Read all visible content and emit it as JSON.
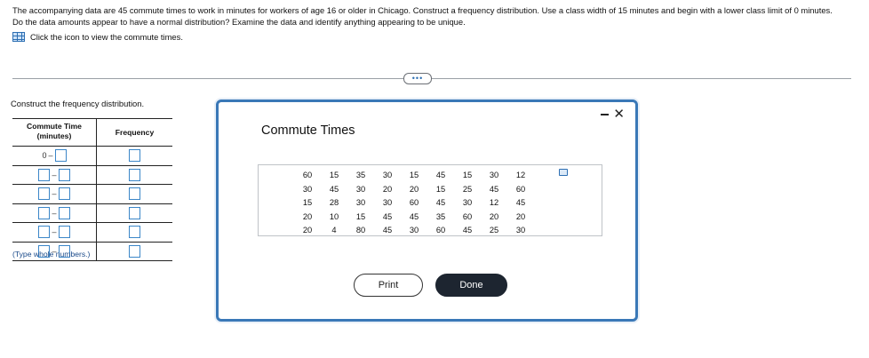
{
  "prompt": {
    "text": "The accompanying data are 45 commute times to work in minutes for workers of age 16 or older in Chicago. Construct a frequency distribution. Use a class width of 15 minutes and begin with a lower class limit of 0 minutes. Do the data amounts appear to have a normal distribution? Examine the data and identify anything appearing to be unique.",
    "icon_link_label": "Click the icon to view the commute times."
  },
  "more_button_label": "•••",
  "frequency": {
    "label": "Construct the frequency distribution.",
    "header_time": "Commute Time (minutes)",
    "header_freq": "Frequency",
    "first_lower": "0",
    "dash": "–",
    "note": "(Type whole numbers.)"
  },
  "modal": {
    "title": "Commute Times",
    "minimize_glyph": "-",
    "close_glyph": "✕",
    "rows": [
      [
        "60",
        "15",
        "35",
        "30",
        "15",
        "45",
        "15",
        "30",
        "12"
      ],
      [
        "30",
        "45",
        "30",
        "20",
        "20",
        "15",
        "25",
        "45",
        "60"
      ],
      [
        "15",
        "28",
        "30",
        "30",
        "60",
        "45",
        "30",
        "12",
        "45"
      ],
      [
        "20",
        "10",
        "15",
        "45",
        "45",
        "35",
        "60",
        "20",
        "20"
      ],
      [
        "20",
        "4",
        "80",
        "45",
        "30",
        "60",
        "45",
        "25",
        "30"
      ]
    ],
    "print_label": "Print",
    "done_label": "Done"
  },
  "colors": {
    "accent": "#3a78b7",
    "input_border": "#3b86c8",
    "done_bg": "#1d2530"
  }
}
